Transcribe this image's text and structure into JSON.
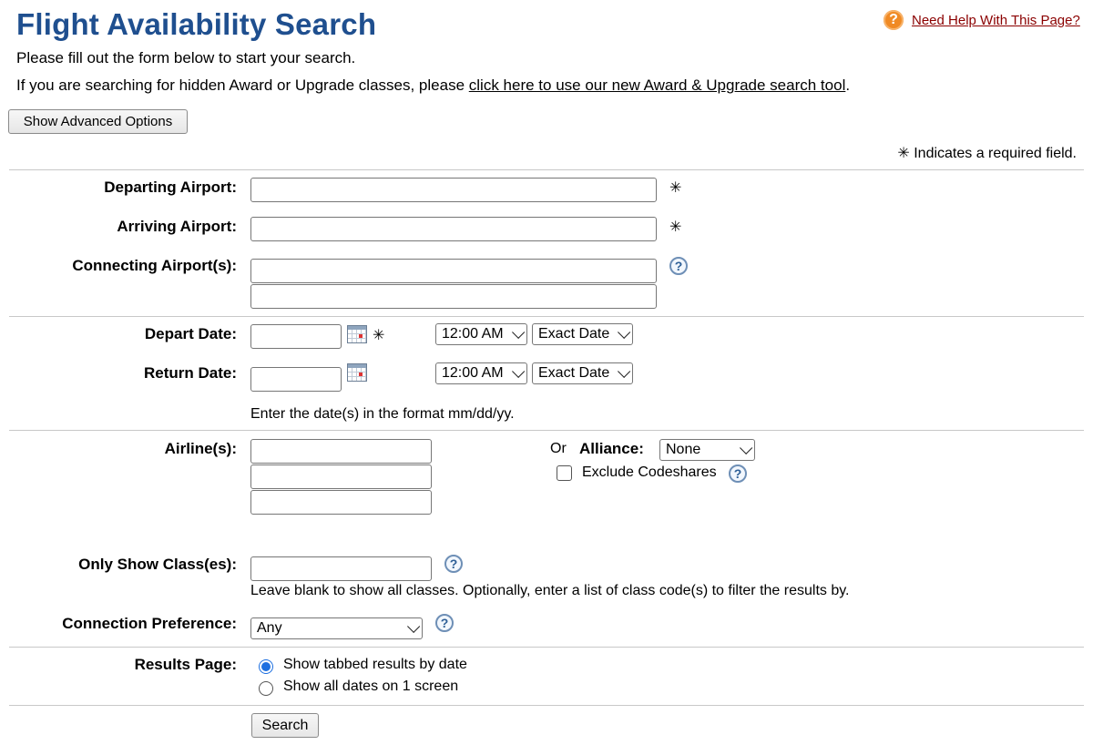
{
  "header": {
    "title": "Flight Availability Search",
    "help_link": "Need Help With This Page?"
  },
  "intro": {
    "line1": "Please fill out the form below to start your search.",
    "line2_prefix": "If you are searching for hidden Award or Upgrade classes, please ",
    "line2_link": "click here to use our new Award & Upgrade search tool",
    "line2_suffix": "."
  },
  "advanced_button": "Show Advanced Options",
  "required_note": "Indicates a required field.",
  "required_symbol": "✳",
  "airports": {
    "departing_label": "Departing Airport:",
    "departing_value": "",
    "arriving_label": "Arriving Airport:",
    "arriving_value": "",
    "connecting_label": "Connecting Airport(s):",
    "connecting_values": [
      "",
      ""
    ]
  },
  "dates": {
    "depart_label": "Depart Date:",
    "depart_value": "",
    "depart_time": "12:00 AM",
    "depart_flex": "Exact Date",
    "return_label": "Return Date:",
    "return_value": "",
    "return_time": "12:00 AM",
    "return_flex": "Exact Date",
    "format_hint": "Enter the date(s) in the format mm/dd/yy."
  },
  "airlines": {
    "label": "Airline(s):",
    "values": [
      "",
      "",
      ""
    ],
    "or_text": "Or",
    "alliance_label": "Alliance:",
    "alliance_value": "None",
    "exclude_codeshares_label": "Exclude Codeshares",
    "exclude_codeshares_checked": false
  },
  "classes": {
    "label": "Only Show Class(es):",
    "value": "",
    "hint": "Leave blank to show all classes. Optionally, enter a list of class code(s) to filter the results by."
  },
  "connection": {
    "label": "Connection Preference:",
    "value": "Any"
  },
  "results": {
    "label": "Results Page:",
    "options": [
      "Show tabbed results by date",
      "Show all dates on 1 screen"
    ],
    "selected_index": 0
  },
  "search_button": "Search",
  "icons": {
    "help": "question-mark-circle-icon",
    "calendar": "calendar-icon"
  },
  "colors": {
    "title": "#1f4f8f",
    "help_link": "#8b0000",
    "help_icon": "#f08a24",
    "radio_selected": "#1d6fe0"
  }
}
